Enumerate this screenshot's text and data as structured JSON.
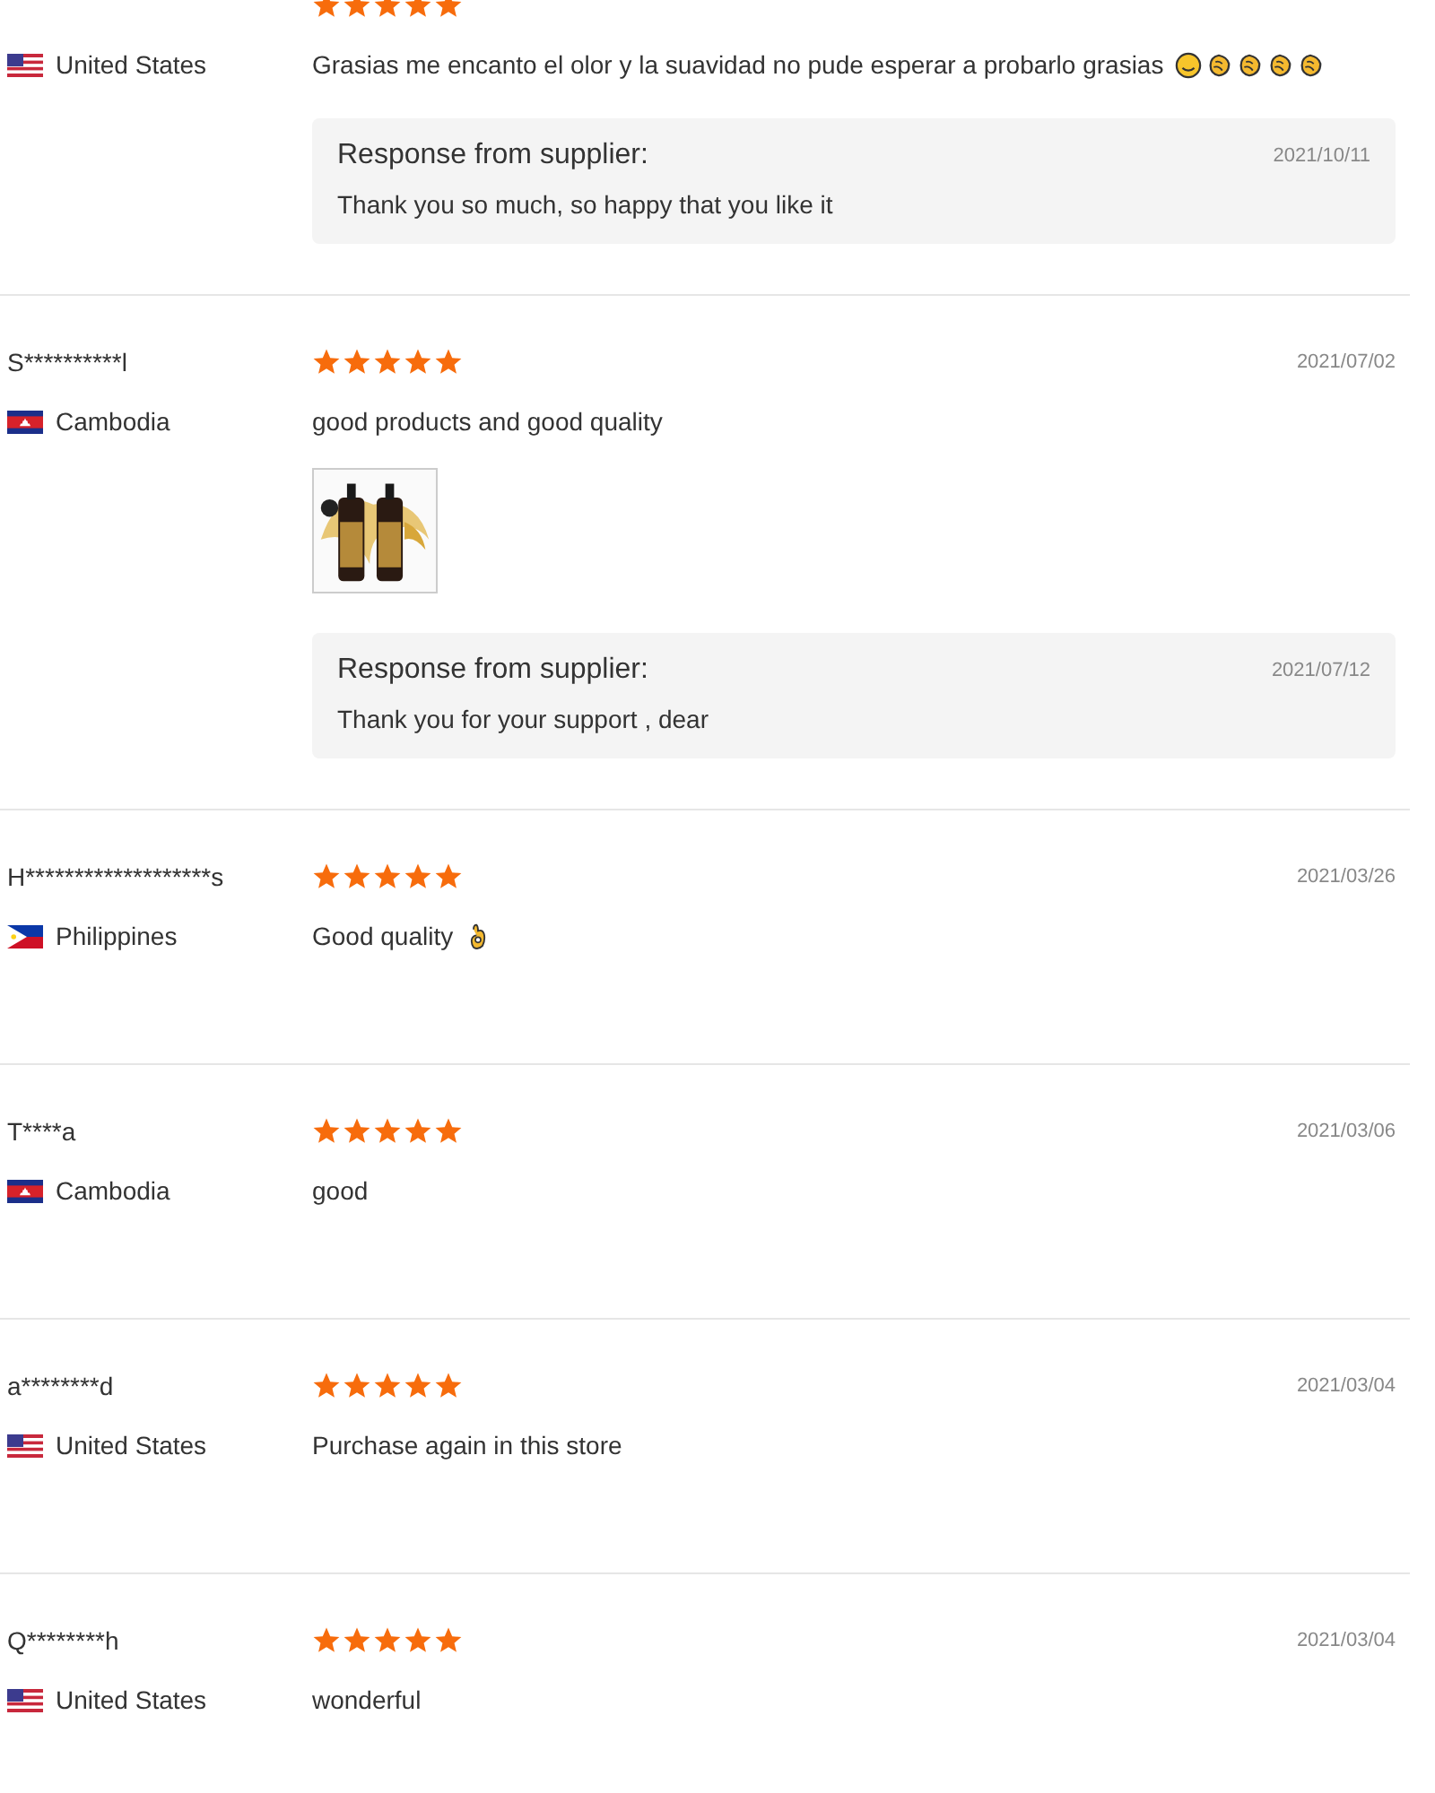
{
  "reviews": [
    {
      "stars": 5,
      "country": "United States",
      "flag": {
        "kind": "us"
      },
      "text": "Grasias me encanto el olor y la suavidad no pude esperar a probarlo grasias",
      "emojis": [
        {
          "kind": "smile"
        },
        {
          "kind": "clap"
        },
        {
          "kind": "clap"
        },
        {
          "kind": "clap"
        },
        {
          "kind": "clap"
        }
      ],
      "response": {
        "title": "Response from supplier:",
        "date": "2021/10/11",
        "text": "Thank you so much, so happy that you like it"
      }
    },
    {
      "user": "S**********l",
      "stars": 5,
      "date": "2021/07/02",
      "country": "Cambodia",
      "flag": {
        "kind": "kh"
      },
      "text": "good products and good quality",
      "photos": [
        {
          "kind": "picture"
        }
      ],
      "response": {
        "title": "Response from supplier:",
        "date": "2021/07/12",
        "text": "Thank you for your support , dear"
      }
    },
    {
      "user": "H*******************s",
      "stars": 5,
      "date": "2021/03/26",
      "country": "Philippines",
      "flag": {
        "kind": "ph"
      },
      "text": "Good quality",
      "emojis": [
        {
          "kind": "ok"
        }
      ]
    },
    {
      "user": "T****a",
      "stars": 5,
      "date": "2021/03/06",
      "country": "Cambodia",
      "flag": {
        "kind": "kh"
      },
      "text": "good"
    },
    {
      "user": "a********d",
      "stars": 5,
      "date": "2021/03/04",
      "country": "United States",
      "flag": {
        "kind": "us"
      },
      "text": "Purchase again in this store"
    },
    {
      "user": "Q********h",
      "stars": 5,
      "date": "2021/03/04",
      "country": "United States",
      "flag": {
        "kind": "us"
      },
      "text": "wonderful"
    }
  ]
}
